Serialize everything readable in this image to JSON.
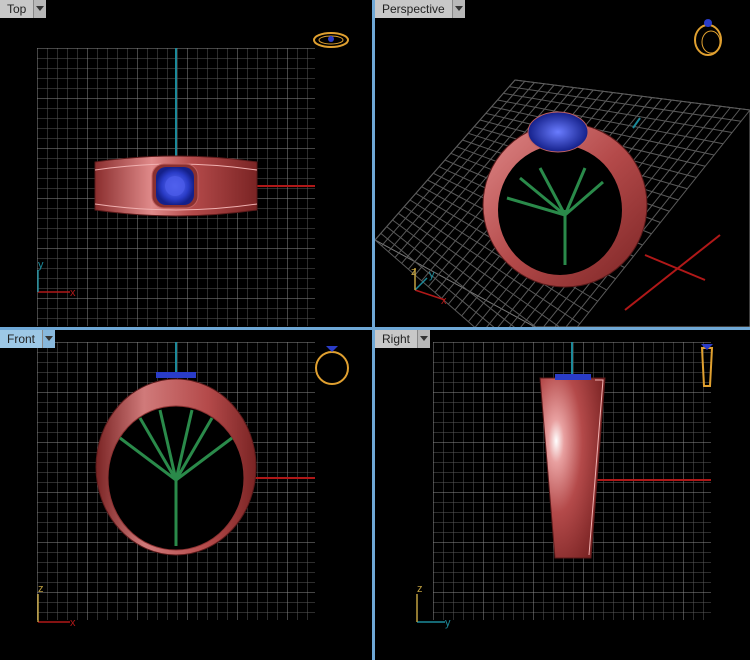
{
  "viewports": {
    "top": {
      "label": "Top",
      "axis_h": "x",
      "axis_v": "y"
    },
    "perspective": {
      "label": "Perspective",
      "axis_h": "x",
      "axis_v": "y",
      "axis_z": "z"
    },
    "front": {
      "label": "Front",
      "axis_h": "x",
      "axis_v": "z"
    },
    "right": {
      "label": "Right",
      "axis_h": "y",
      "axis_v": "z"
    }
  },
  "colors": {
    "active_tab": "#9dc8e6",
    "inactive_tab": "#c8c8c8",
    "grid_line": "#6e6e6e",
    "grid_major": "#9a9a9a",
    "x_axis": "#b01818",
    "y_axis": "#1c8a9a",
    "ring_metal": "#b44a4a",
    "gem": "#2a3cc8",
    "prongs": "#2a8a4a",
    "view_icon": "#e0a030"
  },
  "icons": {
    "dropdown": "chevron-down-icon",
    "view_cube": "ring-view-icon"
  }
}
